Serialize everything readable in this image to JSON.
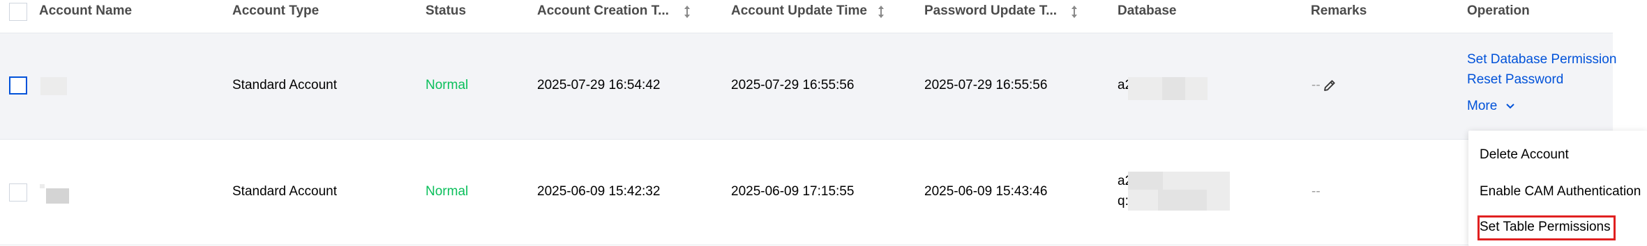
{
  "columns": {
    "account_name": "Account Name",
    "account_type": "Account Type",
    "status": "Status",
    "account_creation_time": "Account Creation T...",
    "account_update_time": "Account Update Time",
    "password_update_time": "Password Update T...",
    "database": "Database",
    "remarks": "Remarks",
    "operation": "Operation"
  },
  "rows": [
    {
      "account_type": "Standard Account",
      "status": "Normal",
      "creation_time": "2025-07-29 16:54:42",
      "update_time": "2025-07-29 16:55:56",
      "password_update_time": "2025-07-29 16:55:56",
      "database_line1": "a2",
      "remarks": "--",
      "operations": {
        "set_db_permission": "Set Database Permission",
        "reset_password": "Reset Password",
        "more": "More"
      }
    },
    {
      "account_type": "Standard Account",
      "status": "Normal",
      "creation_time": "2025-06-09 15:42:32",
      "update_time": "2025-06-09 17:15:55",
      "password_update_time": "2025-06-09 15:43:46",
      "database_line1": "a2",
      "database_line2": "q:",
      "remarks": "--"
    }
  ],
  "more_menu": {
    "items": [
      "Delete Account",
      "Enable CAM Authentication",
      "Set Table Permissions"
    ]
  },
  "colors": {
    "status_normal": "#0abf5b",
    "link": "#0052d9",
    "highlight": "#e02020",
    "selected_row": "#f3f4f7"
  },
  "icons": [
    "sort-icon",
    "pencil-edit-icon",
    "chevron-down-icon"
  ]
}
